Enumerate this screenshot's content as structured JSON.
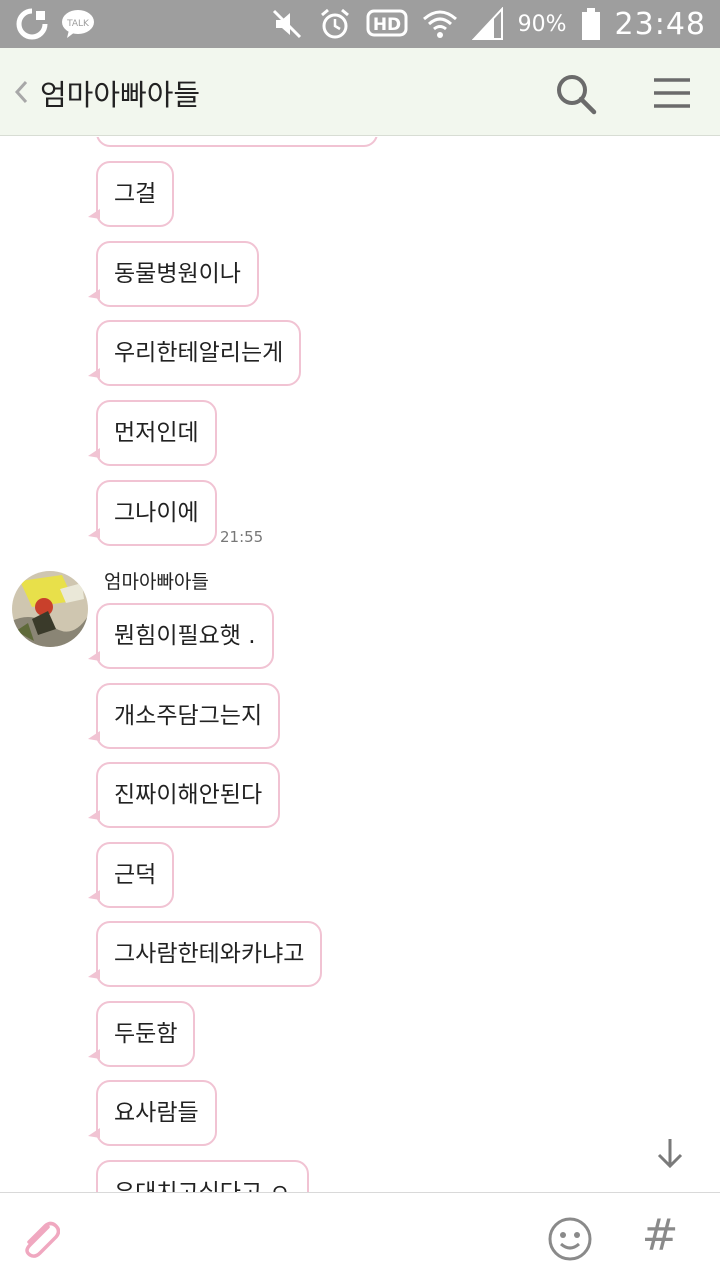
{
  "status_bar": {
    "battery_pct": "90%",
    "clock": "23:48",
    "hd_label": "HD",
    "talk_label": "TALK",
    "icons": [
      "o-app-icon",
      "kakaotalk-icon",
      "mute-icon",
      "alarm-icon",
      "hd-voice-icon",
      "wifi-icon",
      "signal-icon",
      "battery-icon"
    ]
  },
  "header": {
    "title": "엄마아빠아들",
    "icons": [
      "back-icon",
      "search-icon",
      "menu-icon"
    ]
  },
  "messages": {
    "group1": [
      "그걸",
      "동물병원이나",
      "우리한테알리는게",
      "먼저인데",
      "그나이에"
    ],
    "group1_time": "21:55",
    "sender_name": "엄마아빠아들",
    "group2": [
      "뭔힘이필요햇 .",
      "개소주담그는지",
      "진짜이해안된다",
      "근덕",
      "그사람한테와카냐고",
      "두둔함",
      "요사람들",
      "우대치고싶다고 ㅇ"
    ]
  },
  "input_bar": {
    "hash_label": "#",
    "icons": [
      "paperclip-icon",
      "emoticon-icon",
      "hashtag-icon"
    ]
  },
  "colors": {
    "status_bar_bg": "#9e9e9e",
    "header_bg": "#f2f7ee",
    "bubble_border": "#f1c3d3"
  }
}
